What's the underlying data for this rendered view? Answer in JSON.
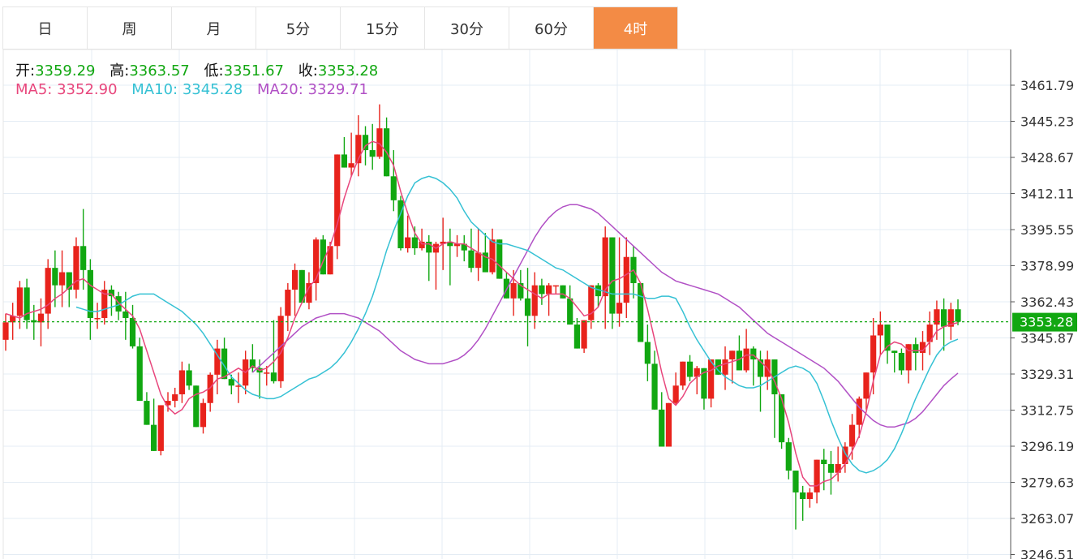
{
  "tabs": [
    {
      "label": "日",
      "active": false
    },
    {
      "label": "周",
      "active": false
    },
    {
      "label": "月",
      "active": false
    },
    {
      "label": "5分",
      "active": false
    },
    {
      "label": "15分",
      "active": false
    },
    {
      "label": "30分",
      "active": false
    },
    {
      "label": "60分",
      "active": false
    },
    {
      "label": "4时",
      "active": true
    }
  ],
  "info": {
    "open_label": "开:",
    "open": "3359.29",
    "high_label": "高:",
    "high": "3363.57",
    "low_label": "低:",
    "low": "3351.67",
    "close_label": "收:",
    "close": "3353.28",
    "ma5_label": "MA5:",
    "ma5": "3352.90",
    "ma10_label": "MA10:",
    "ma10": "3345.28",
    "ma20_label": "MA20:",
    "ma20": "3329.71"
  },
  "colors": {
    "up": "#e8231c",
    "down": "#11a711",
    "ma5": "#e8467c",
    "ma10": "#35c1d4",
    "ma20": "#b150c5",
    "price_tag": "#11a711",
    "active_tab": "#f38b45",
    "grid": "#e4ecf4"
  },
  "chart_data": {
    "type": "candlestick",
    "ylim": [
      3246.51,
      3472.0
    ],
    "y_ticks": [
      3461.79,
      3445.23,
      3428.67,
      3412.11,
      3395.55,
      3378.99,
      3362.43,
      3345.87,
      3329.31,
      3312.75,
      3296.19,
      3279.63,
      3263.07,
      3246.51
    ],
    "y_tick_labels": [
      "3461.79",
      "3445.23",
      "3428.67",
      "3412.11",
      "3395.55",
      "3378.99",
      "3362.43",
      "3345.87",
      "3329.31",
      "3312.75",
      "3296.19",
      "3279.63",
      "3263.07",
      "3246.51"
    ],
    "last_price": 3353.28,
    "last_price_label": "3353.28",
    "candles": [
      [
        3345,
        3357,
        3340,
        3353
      ],
      [
        3353,
        3362,
        3345,
        3356
      ],
      [
        3356,
        3372,
        3350,
        3369
      ],
      [
        3369,
        3373,
        3350,
        3354
      ],
      [
        3354,
        3361,
        3345,
        3353
      ],
      [
        3353,
        3364,
        3342,
        3357
      ],
      [
        3357,
        3382,
        3350,
        3378
      ],
      [
        3378,
        3386,
        3360,
        3370
      ],
      [
        3370,
        3386,
        3360,
        3376
      ],
      [
        3376,
        3376,
        3360,
        3368
      ],
      [
        3368,
        3392,
        3364,
        3388
      ],
      [
        3388,
        3405,
        3368,
        3377
      ],
      [
        3377,
        3382,
        3345,
        3355
      ],
      [
        3355,
        3362,
        3350,
        3355
      ],
      [
        3355,
        3372,
        3352,
        3368
      ],
      [
        3368,
        3370,
        3356,
        3365
      ],
      [
        3365,
        3367,
        3354,
        3358
      ],
      [
        3358,
        3367,
        3345,
        3355
      ],
      [
        3355,
        3361,
        3341,
        3342
      ],
      [
        3342,
        3346,
        3318,
        3317
      ],
      [
        3317,
        3321,
        3311,
        3306
      ],
      [
        3306,
        3318,
        3294,
        3294
      ],
      [
        3294,
        3314,
        3292,
        3315
      ],
      [
        3315,
        3321,
        3312,
        3317
      ],
      [
        3317,
        3323,
        3314,
        3320
      ],
      [
        3320,
        3335,
        3316,
        3331
      ],
      [
        3331,
        3334,
        3322,
        3324
      ],
      [
        3324,
        3323,
        3305,
        3305
      ],
      [
        3305,
        3318,
        3302,
        3316
      ],
      [
        3316,
        3330,
        3312,
        3329
      ],
      [
        3329,
        3345,
        3320,
        3341
      ],
      [
        3341,
        3346,
        3327,
        3327
      ],
      [
        3327,
        3329,
        3320,
        3324
      ],
      [
        3324,
        3330,
        3316,
        3324
      ],
      [
        3324,
        3340,
        3320,
        3336
      ],
      [
        3336,
        3343,
        3330,
        3332
      ],
      [
        3332,
        3336,
        3318,
        3330
      ],
      [
        3330,
        3333,
        3324,
        3330
      ],
      [
        3330,
        3354,
        3325,
        3326
      ],
      [
        3326,
        3360,
        3323,
        3356
      ],
      [
        3356,
        3371,
        3349,
        3368
      ],
      [
        3368,
        3380,
        3356,
        3377
      ],
      [
        3377,
        3371,
        3366,
        3362
      ],
      [
        3362,
        3376,
        3359,
        3371
      ],
      [
        3371,
        3392,
        3363,
        3391
      ],
      [
        3391,
        3393,
        3377,
        3375
      ],
      [
        3375,
        3390,
        3382,
        3388
      ],
      [
        3388,
        3430,
        3382,
        3430
      ],
      [
        3430,
        3438,
        3424,
        3424
      ],
      [
        3424,
        3440,
        3420,
        3426
      ],
      [
        3426,
        3448,
        3420,
        3439
      ],
      [
        3439,
        3443,
        3425,
        3432
      ],
      [
        3432,
        3444,
        3423,
        3429
      ],
      [
        3429,
        3453,
        3428,
        3442
      ],
      [
        3442,
        3447,
        3420,
        3420
      ],
      [
        3420,
        3432,
        3404,
        3409
      ],
      [
        3409,
        3411,
        3386,
        3387
      ],
      [
        3387,
        3402,
        3385,
        3392
      ],
      [
        3392,
        3397,
        3384,
        3387
      ],
      [
        3387,
        3396,
        3386,
        3390
      ],
      [
        3390,
        3393,
        3372,
        3385
      ],
      [
        3385,
        3390,
        3368,
        3389
      ],
      [
        3389,
        3401,
        3377,
        3390
      ],
      [
        3390,
        3396,
        3370,
        3388
      ],
      [
        3388,
        3393,
        3383,
        3389
      ],
      [
        3389,
        3393,
        3381,
        3386
      ],
      [
        3386,
        3396,
        3376,
        3378
      ],
      [
        3378,
        3396,
        3372,
        3385
      ],
      [
        3385,
        3394,
        3380,
        3376
      ],
      [
        3376,
        3396,
        3375,
        3391
      ],
      [
        3391,
        3389,
        3376,
        3373
      ],
      [
        3373,
        3376,
        3364,
        3364
      ],
      [
        3364,
        3377,
        3356,
        3371
      ],
      [
        3371,
        3377,
        3363,
        3364
      ],
      [
        3364,
        3378,
        3342,
        3356
      ],
      [
        3356,
        3376,
        3350,
        3370
      ],
      [
        3370,
        3373,
        3361,
        3366
      ],
      [
        3366,
        3371,
        3356,
        3370
      ],
      [
        3370,
        3369,
        3366,
        3370
      ],
      [
        3370,
        3370,
        3364,
        3364
      ],
      [
        3364,
        3370,
        3360,
        3352
      ],
      [
        3352,
        3355,
        3341,
        3341
      ],
      [
        3341,
        3348,
        3339,
        3354
      ],
      [
        3354,
        3360,
        3350,
        3370
      ],
      [
        3370,
        3371,
        3360,
        3365
      ],
      [
        3365,
        3397,
        3350,
        3392
      ],
      [
        3392,
        3390,
        3350,
        3357
      ],
      [
        3357,
        3392,
        3351,
        3362
      ],
      [
        3362,
        3392,
        3355,
        3383
      ],
      [
        3383,
        3388,
        3364,
        3371
      ],
      [
        3371,
        3370,
        3348,
        3344
      ],
      [
        3344,
        3352,
        3326,
        3334
      ],
      [
        3334,
        3340,
        3313,
        3313
      ],
      [
        3313,
        3321,
        3296,
        3296
      ],
      [
        3296,
        3316,
        3300,
        3316
      ],
      [
        3316,
        3330,
        3315,
        3324
      ],
      [
        3324,
        3335,
        3322,
        3335
      ],
      [
        3335,
        3338,
        3326,
        3328
      ],
      [
        3328,
        3333,
        3320,
        3332
      ],
      [
        3332,
        3328,
        3313,
        3318
      ],
      [
        3318,
        3334,
        3314,
        3336
      ],
      [
        3336,
        3335,
        3330,
        3329
      ],
      [
        3329,
        3342,
        3322,
        3336
      ],
      [
        3336,
        3337,
        3325,
        3340
      ],
      [
        3340,
        3347,
        3332,
        3331
      ],
      [
        3331,
        3350,
        3330,
        3341
      ],
      [
        3341,
        3342,
        3324,
        3336
      ],
      [
        3336,
        3340,
        3312,
        3328
      ],
      [
        3328,
        3340,
        3322,
        3336
      ],
      [
        3336,
        3328,
        3300,
        3320
      ],
      [
        3320,
        3313,
        3295,
        3298
      ],
      [
        3298,
        3300,
        3281,
        3285
      ],
      [
        3285,
        3281,
        3258,
        3275
      ],
      [
        3275,
        3278,
        3262,
        3272
      ],
      [
        3272,
        3277,
        3268,
        3275
      ],
      [
        3275,
        3290,
        3270,
        3290
      ],
      [
        3290,
        3295,
        3276,
        3288
      ],
      [
        3288,
        3294,
        3274,
        3284
      ],
      [
        3284,
        3296,
        3280,
        3288
      ],
      [
        3288,
        3298,
        3284,
        3296
      ],
      [
        3296,
        3311,
        3290,
        3306
      ],
      [
        3306,
        3319,
        3300,
        3318
      ],
      [
        3318,
        3327,
        3313,
        3330
      ],
      [
        3330,
        3355,
        3320,
        3347
      ],
      [
        3347,
        3358,
        3338,
        3352
      ],
      [
        3352,
        3346,
        3334,
        3340
      ],
      [
        3340,
        3338,
        3330,
        3339
      ],
      [
        3339,
        3341,
        3329,
        3331
      ],
      [
        3331,
        3341,
        3325,
        3343
      ],
      [
        3343,
        3346,
        3331,
        3339
      ],
      [
        3339,
        3349,
        3331,
        3344
      ],
      [
        3344,
        3358,
        3338,
        3352
      ],
      [
        3352,
        3363,
        3345,
        3359
      ],
      [
        3359,
        3364,
        3340,
        3351
      ],
      [
        3351,
        3362,
        3345,
        3359
      ],
      [
        3359,
        3363.57,
        3351.67,
        3353.28
      ]
    ],
    "ma5": [
      3357,
      3356,
      3355,
      3357,
      3358,
      3359,
      3361,
      3364,
      3366,
      3369,
      3372,
      3373,
      3370,
      3368,
      3366,
      3366,
      3362,
      3359,
      3356,
      3350,
      3340,
      3330,
      3320,
      3314,
      3311,
      3313,
      3318,
      3320,
      3321,
      3323,
      3327,
      3328,
      3330,
      3332,
      3330,
      3333,
      3331,
      3332,
      3335,
      3339,
      3346,
      3355,
      3362,
      3369,
      3373,
      3381,
      3388,
      3398,
      3410,
      3420,
      3428,
      3434,
      3436,
      3435,
      3431,
      3425,
      3413,
      3403,
      3394,
      3389,
      3389,
      3387,
      3389,
      3390,
      3389,
      3389,
      3387,
      3385,
      3383,
      3382,
      3379,
      3376,
      3373,
      3370,
      3368,
      3366,
      3364,
      3366,
      3366,
      3366,
      3364,
      3360,
      3356,
      3357,
      3360,
      3368,
      3372,
      3373,
      3375,
      3377,
      3371,
      3359,
      3345,
      3330,
      3318,
      3315,
      3319,
      3325,
      3328,
      3330,
      3331,
      3333,
      3334,
      3335,
      3336,
      3338,
      3338,
      3335,
      3332,
      3326,
      3318,
      3307,
      3293,
      3282,
      3278,
      3278,
      3280,
      3281,
      3284,
      3288,
      3294,
      3301,
      3312,
      3326,
      3338,
      3342,
      3344,
      3343,
      3340,
      3340,
      3340,
      3344,
      3349,
      3351,
      3352,
      3352.9
    ],
    "ma10": [
      3360,
      3359,
      3358,
      3358,
      3359,
      3360,
      3361,
      3363,
      3365,
      3366,
      3366,
      3366,
      3364,
      3362,
      3360,
      3358,
      3355,
      3352,
      3348,
      3343,
      3338,
      3333,
      3328,
      3325,
      3322,
      3320,
      3319,
      3318,
      3318,
      3319,
      3321,
      3323,
      3325,
      3327,
      3328,
      3330,
      3332,
      3335,
      3339,
      3344,
      3350,
      3357,
      3365,
      3375,
      3386,
      3395,
      3403,
      3411,
      3417,
      3419,
      3420,
      3419,
      3417,
      3414,
      3410,
      3404,
      3399,
      3396,
      3393,
      3390,
      3389,
      3389,
      3388,
      3387,
      3386,
      3384,
      3382,
      3380,
      3378,
      3377,
      3375,
      3373,
      3371,
      3369,
      3368,
      3367,
      3366,
      3366,
      3366,
      3366,
      3365,
      3364,
      3364,
      3365,
      3365,
      3364,
      3358,
      3351,
      3345,
      3340,
      3335,
      3331,
      3328,
      3326,
      3324,
      3323,
      3323,
      3324,
      3326,
      3328,
      3330,
      3332,
      3333,
      3332,
      3330,
      3325,
      3317,
      3308,
      3300,
      3293,
      3288,
      3285,
      3284,
      3285,
      3287,
      3290,
      3295,
      3302,
      3310,
      3318,
      3325,
      3332,
      3338,
      3342,
      3344,
      3345.28
    ],
    "ma20": [
      3330,
      3333,
      3336,
      3339,
      3342,
      3345,
      3348,
      3351,
      3353,
      3355,
      3356,
      3357,
      3357,
      3357,
      3356,
      3355,
      3353,
      3351,
      3349,
      3346,
      3343,
      3340,
      3338,
      3336,
      3335,
      3334,
      3334,
      3334,
      3335,
      3336,
      3338,
      3341,
      3345,
      3350,
      3356,
      3362,
      3368,
      3374,
      3380,
      3386,
      3392,
      3397,
      3401,
      3404,
      3406,
      3407,
      3407,
      3406,
      3405,
      3403,
      3400,
      3397,
      3394,
      3391,
      3388,
      3385,
      3382,
      3379,
      3376,
      3374,
      3372,
      3371,
      3370,
      3369,
      3368,
      3367,
      3366,
      3364,
      3362,
      3360,
      3357,
      3354,
      3351,
      3348,
      3346,
      3344,
      3342,
      3340,
      3338,
      3336,
      3334,
      3332,
      3329,
      3326,
      3322,
      3318,
      3314,
      3311,
      3308,
      3306,
      3305,
      3305,
      3306,
      3307,
      3309,
      3312,
      3316,
      3320,
      3324,
      3327,
      3329.71
    ]
  }
}
